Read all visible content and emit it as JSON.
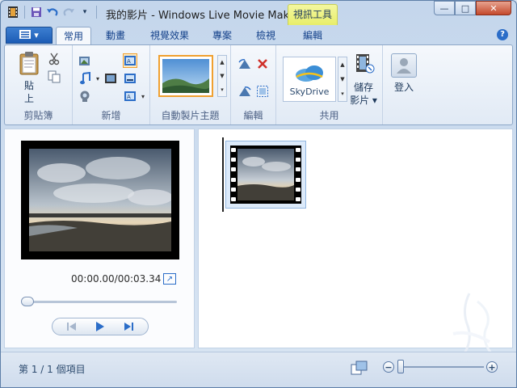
{
  "window": {
    "title": "我的影片 - Windows Live Movie Maker",
    "context_tab": "視訊工具",
    "caption": {
      "minimize": "—",
      "maximize": "□",
      "close": "✕"
    }
  },
  "tabs": {
    "app_menu_icon": "app-menu-icon",
    "items": [
      {
        "label": "常用",
        "active": true
      },
      {
        "label": "動畫",
        "active": false
      },
      {
        "label": "視覺效果",
        "active": false
      },
      {
        "label": "專案",
        "active": false
      },
      {
        "label": "檢視",
        "active": false
      },
      {
        "label": "編輯",
        "active": false
      }
    ],
    "help": "?"
  },
  "ribbon": {
    "clipboard": {
      "label": "剪貼簿",
      "paste": "貼\n上"
    },
    "add": {
      "label": "新增"
    },
    "autotheme": {
      "label": "自動製片主題"
    },
    "editing": {
      "label": "編輯"
    },
    "share": {
      "label": "共用",
      "skydrive": "SkyDrive",
      "save_movie": "儲存",
      "save_movie_2": "影片 ▾"
    },
    "signin": {
      "label": "登入"
    }
  },
  "preview": {
    "time": "00:00.00/00:03.34",
    "seek_progress": 0
  },
  "status": {
    "text": "第 1 / 1 個項目"
  },
  "colors": {
    "accent": "#2b6dc8",
    "context_tab": "#e8ee6a",
    "theme_highlight": "#f0a030"
  }
}
